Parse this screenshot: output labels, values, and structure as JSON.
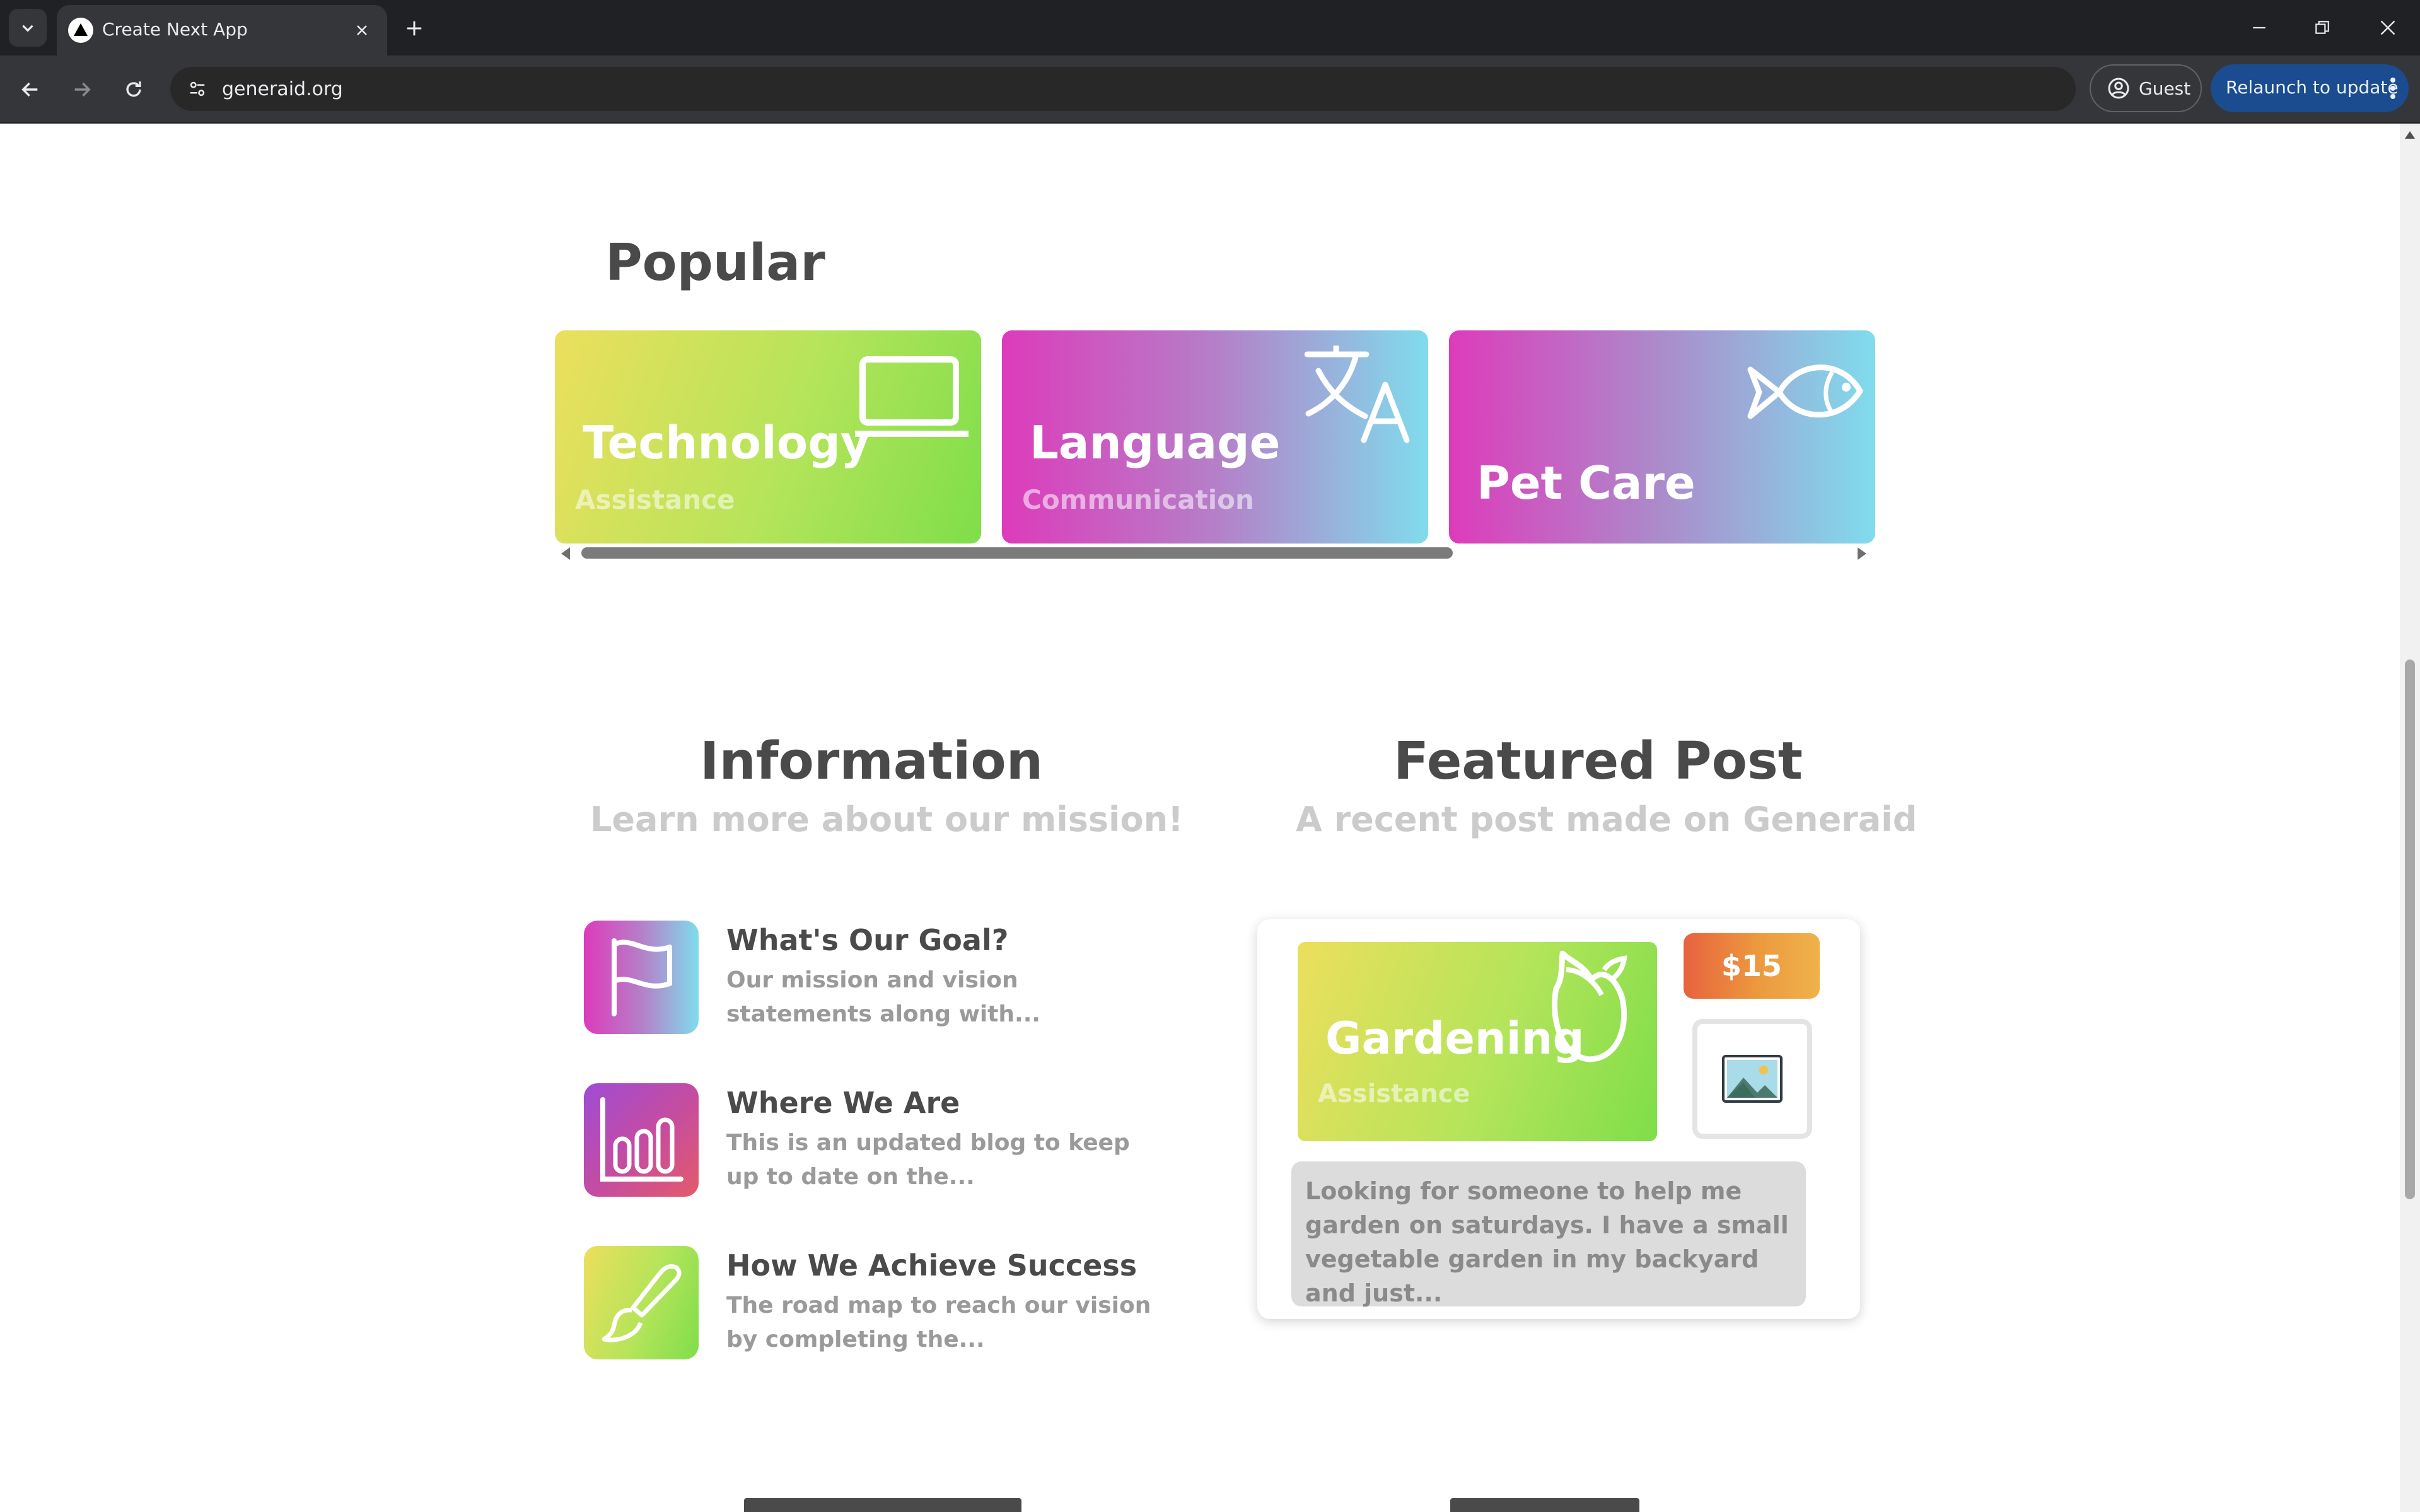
{
  "browser": {
    "tab_title": "Create Next App",
    "url": "generaid.org",
    "guest_label": "Guest",
    "relaunch_label": "Relaunch to update"
  },
  "popular": {
    "title": "Popular",
    "cards": [
      {
        "name": "Technology",
        "subtitle": "Assistance",
        "icon": "laptop-icon"
      },
      {
        "name": "Language",
        "subtitle": "Communication",
        "icon": "translate-icon"
      },
      {
        "name": "Pet Care",
        "subtitle": "",
        "icon": "fish-icon"
      }
    ]
  },
  "information": {
    "title": "Information",
    "subtitle": "Learn more about our mission!",
    "items": [
      {
        "heading": "What's Our Goal?",
        "description": "Our mission and vision statements along with...",
        "icon": "flag-icon"
      },
      {
        "heading": "Where We Are",
        "description": "This is an updated blog to keep up to date on the...",
        "icon": "bar-chart-icon"
      },
      {
        "heading": "How We Achieve Success",
        "description": "The road map to reach our vision by completing the...",
        "icon": "brush-icon"
      }
    ]
  },
  "featured": {
    "title": "Featured Post",
    "subtitle": "A recent post made on Generaid",
    "post": {
      "category": "Gardening",
      "category_sub": "Assistance",
      "price": "$15",
      "description": "Looking for someone to help me garden on saturdays. I have a small vegetable garden in my backyard and just...",
      "icon": "rose-icon",
      "image_icon": "image-placeholder-icon"
    }
  },
  "colors": {
    "heading": "#4a4a4a",
    "muted": "#cbcbcb",
    "relaunch_bg": "#1b4c8f"
  }
}
